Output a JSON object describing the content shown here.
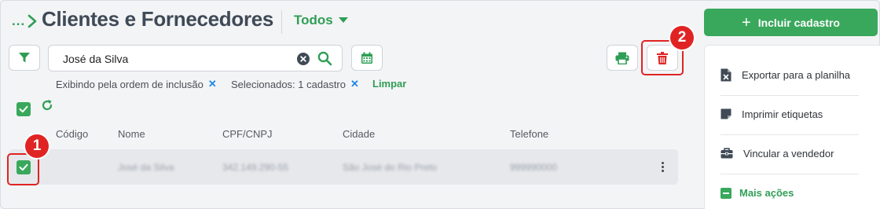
{
  "header": {
    "breadcrumb_ellipsis": "...",
    "title": "Clientes e Fornecedores",
    "filter_dropdown": "Todos",
    "primary_button": "Incluir cadastro"
  },
  "search": {
    "value": "José da Silva"
  },
  "filter_info": {
    "order": "Exibindo pela ordem de inclusão",
    "selected": "Selecionados: 1 cadastro",
    "clear_label": "Limpar",
    "remove_symbol": "✕"
  },
  "table": {
    "columns": [
      "Código",
      "Nome",
      "CPF/CNPJ",
      "Cidade",
      "Telefone"
    ],
    "rows": [
      {
        "code": "",
        "name": "José da Silva",
        "document": "342.149.290-55",
        "city": "São José do Rio Preto",
        "phone": "999990000",
        "selected": true
      }
    ]
  },
  "menu": {
    "items": [
      {
        "label": "Exportar para a planilha",
        "icon": "excel-file-icon"
      },
      {
        "label": "Imprimir etiquetas",
        "icon": "label-icon"
      },
      {
        "label": "Vincular a vendedor",
        "icon": "briefcase-icon"
      }
    ],
    "more_label": "Mais ações"
  },
  "annotations": {
    "step1": "1",
    "step2": "2"
  },
  "colors": {
    "accent_green": "#39a85c",
    "highlight_red": "#e02424",
    "title_gray": "#3f4a56"
  }
}
